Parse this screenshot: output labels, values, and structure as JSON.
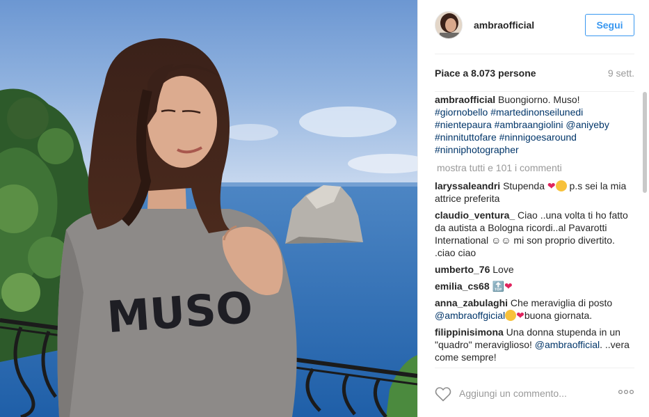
{
  "post": {
    "username": "ambraofficial",
    "follow_label": "Segui",
    "likes": "Piace a 8.073 persone",
    "time": "9 sett."
  },
  "photo": {
    "sweater_text": "MUSO"
  },
  "caption": {
    "user": "ambraofficial",
    "text": "Buongiorno. Muso!",
    "tags": [
      "#giornobello",
      "#martedinonseilunedi",
      "#nientepaura",
      "#ambraangiolini",
      "@aniyeby",
      "#ninnituttofare",
      "#ninnigoesaround",
      "#ninniphotographer"
    ]
  },
  "show_all_comments": "mostra tutti e 101 i commenti",
  "comments": [
    {
      "user": "laryssaleandri",
      "text_a": "Stupenda ",
      "text_b": " p.s sei la mia attrice preferita"
    },
    {
      "user": "claudio_ventura_",
      "text": "Ciao ..una volta ti ho fatto da autista a Bologna ricordi..al Pavarotti International ☺☺ mi son proprio divertito. .ciao ciao"
    },
    {
      "user": "umberto_76",
      "text": "Love"
    },
    {
      "user": "emilia_cs68",
      "text": "🔝❤"
    },
    {
      "user": "anna_zabulaghi",
      "text_a": "Che meraviglia di posto ",
      "tag": "@ambraoffgicial",
      "text_b": "buona giornata."
    },
    {
      "user": "filippinisimona",
      "text_a": "Una donna stupenda in un \"quadro\" meraviglioso! ",
      "tag": "@ambraofficial",
      "text_b": ". ..vera come sempre!"
    }
  ],
  "footer": {
    "comment_placeholder": "Aggiungi un commento...",
    "like_icon": "heart-outline-icon",
    "more_icon": "more-options-icon"
  },
  "colors": {
    "accent": "#3897f0",
    "link": "#003569",
    "muted": "#999999"
  }
}
